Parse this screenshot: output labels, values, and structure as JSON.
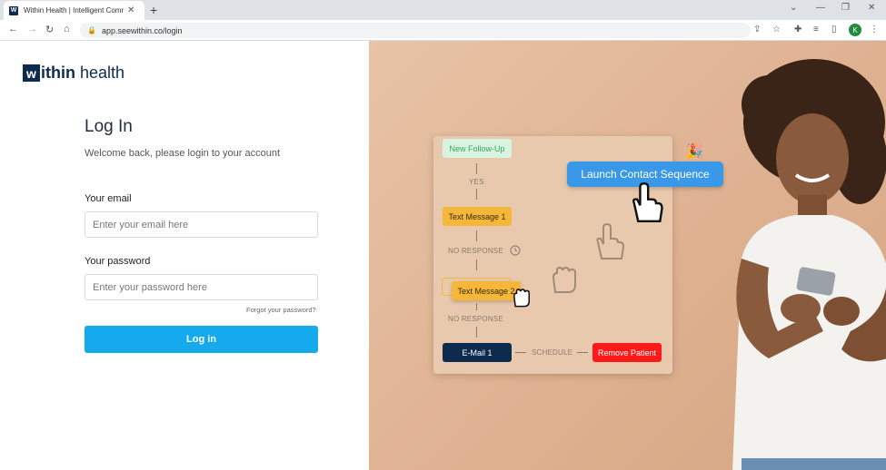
{
  "browser": {
    "tab_title": "Within Health | Intelligent Comm",
    "tab_close": "✕",
    "new_tab": "+",
    "url": "app.seewithin.co/login",
    "profile_initial": "K",
    "controls": {
      "min": "—",
      "restore": "❐",
      "close": "✕",
      "down": "⌄"
    }
  },
  "logo": {
    "mark": "w",
    "word1": "ithin",
    "word2": "health"
  },
  "login": {
    "title": "Log In",
    "subtitle": "Welcome back, please login to your account",
    "email_label": "Your email",
    "email_placeholder": "Enter your email here",
    "password_label": "Your password",
    "password_placeholder": "Enter your password here",
    "forgot": "Forgot your password?",
    "button": "Log in"
  },
  "workflow": {
    "new_follow_up": "New Follow-Up",
    "yes": "YES",
    "text1": "Text Message 1",
    "no_response1": "NO RESPONSE",
    "text2": "Text Message 2",
    "no_response2": "NO RESPONSE",
    "email": "E-Mail 1",
    "schedule": "SCHEDULE",
    "remove": "Remove Patient",
    "launch": "Launch Contact Sequence"
  },
  "colors": {
    "brand_navy": "#0d2b4e",
    "login_button": "#14aaec",
    "launch_button": "#3a98e8",
    "text_node": "#f5b73a",
    "remove_node": "#ff1a1a",
    "new_follow_up": "#d9f3e1"
  }
}
